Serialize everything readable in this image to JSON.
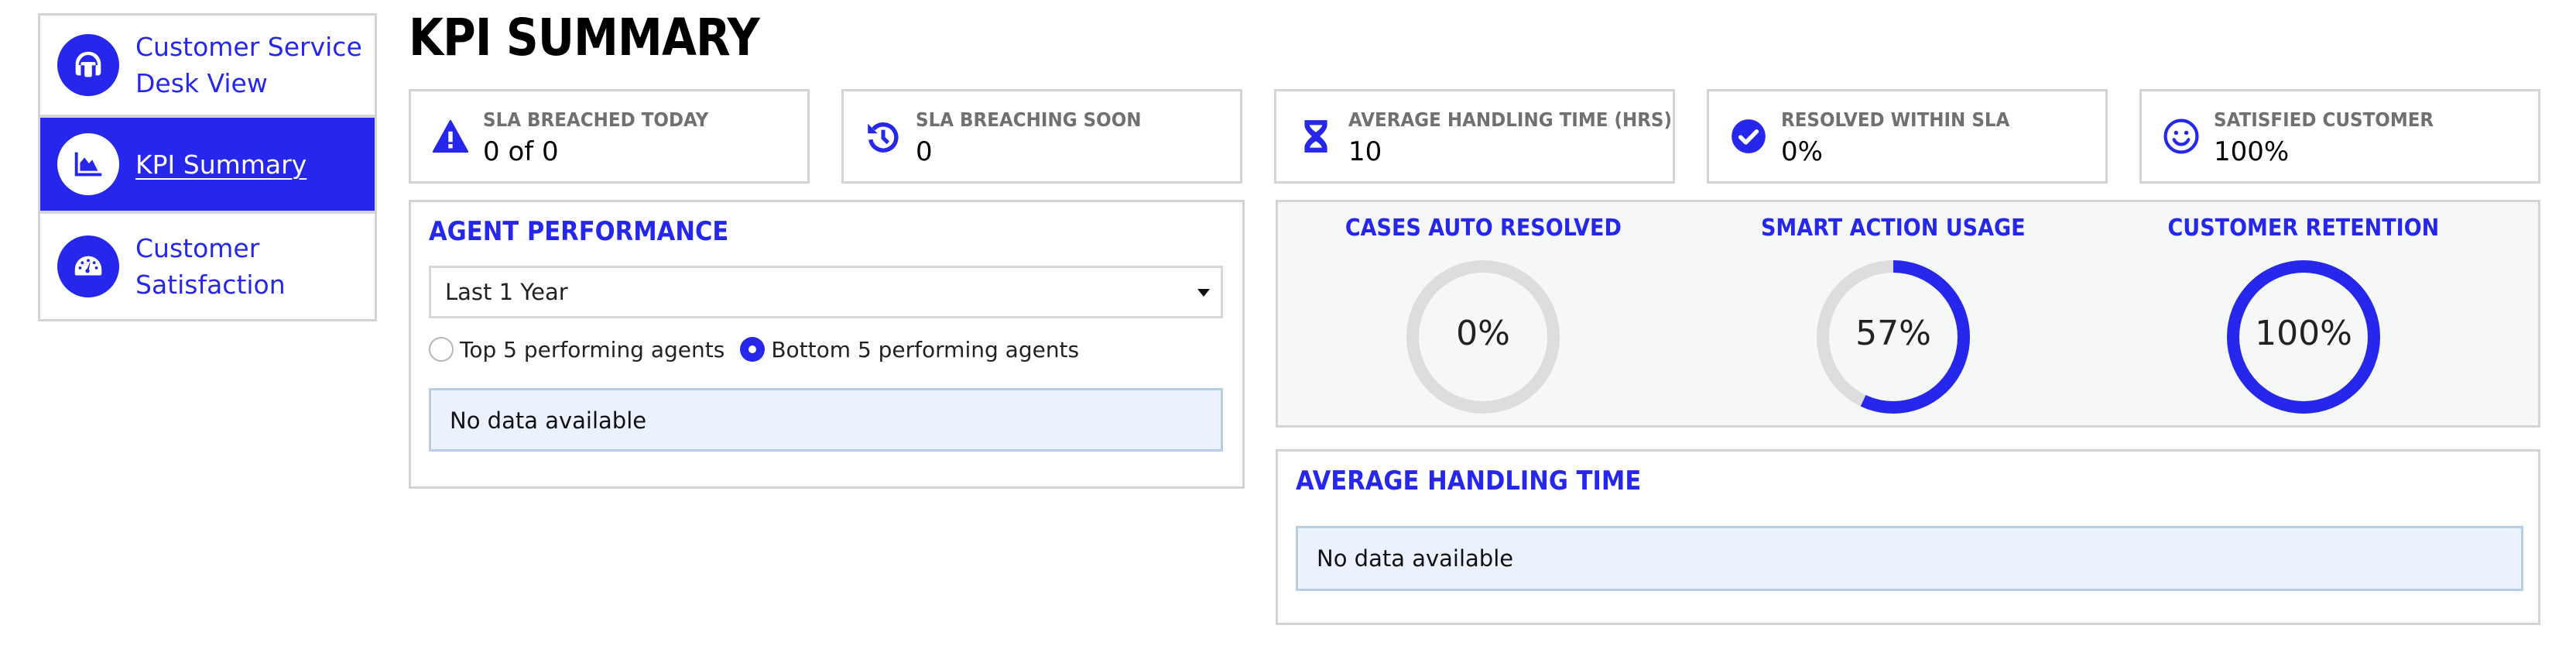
{
  "colors": {
    "accent": "#2626ec",
    "ring_track": "#dddddd",
    "label_gray": "#707070",
    "no_data_bg": "#ebf2fd",
    "panel_bg": "#f6f7f7",
    "border": "#d4d4d4"
  },
  "sidebar": {
    "items": [
      {
        "label": "Customer Service Desk View",
        "icon": "headset-icon",
        "active": false
      },
      {
        "label": "KPI Summary",
        "icon": "area-chart-icon",
        "active": true
      },
      {
        "label": "Customer Satisfaction",
        "icon": "speedometer-icon",
        "active": false
      }
    ]
  },
  "header": {
    "title": "KPI SUMMARY"
  },
  "kpis": [
    {
      "label": "SLA BREACHED TODAY",
      "value": "0 of 0",
      "icon": "warning-icon"
    },
    {
      "label": "SLA BREACHING SOON",
      "value": "0",
      "icon": "history-icon"
    },
    {
      "label": "AVERAGE HANDLING TIME (HRS)",
      "value": "10",
      "icon": "hourglass-icon"
    },
    {
      "label": "RESOLVED WITHIN SLA",
      "value": "0%",
      "icon": "check-circle-icon"
    },
    {
      "label": "SATISFIED CUSTOMER",
      "value": "100%",
      "icon": "smiley-icon"
    }
  ],
  "agent_performance": {
    "title": "AGENT PERFORMANCE",
    "period_select": {
      "value": "Last 1 Year"
    },
    "radios": [
      {
        "label": "Top 5 performing agents",
        "checked": false
      },
      {
        "label": "Bottom 5 performing agents",
        "checked": true
      }
    ],
    "empty_message": "No data available"
  },
  "rings": [
    {
      "title": "CASES AUTO RESOLVED",
      "percent": 0,
      "label": "0%"
    },
    {
      "title": "SMART ACTION USAGE",
      "percent": 57,
      "label": "57%"
    },
    {
      "title": "CUSTOMER RETENTION",
      "percent": 100,
      "label": "100%"
    }
  ],
  "average_handling_time": {
    "title": "AVERAGE HANDLING TIME",
    "empty_message": "No data available"
  }
}
